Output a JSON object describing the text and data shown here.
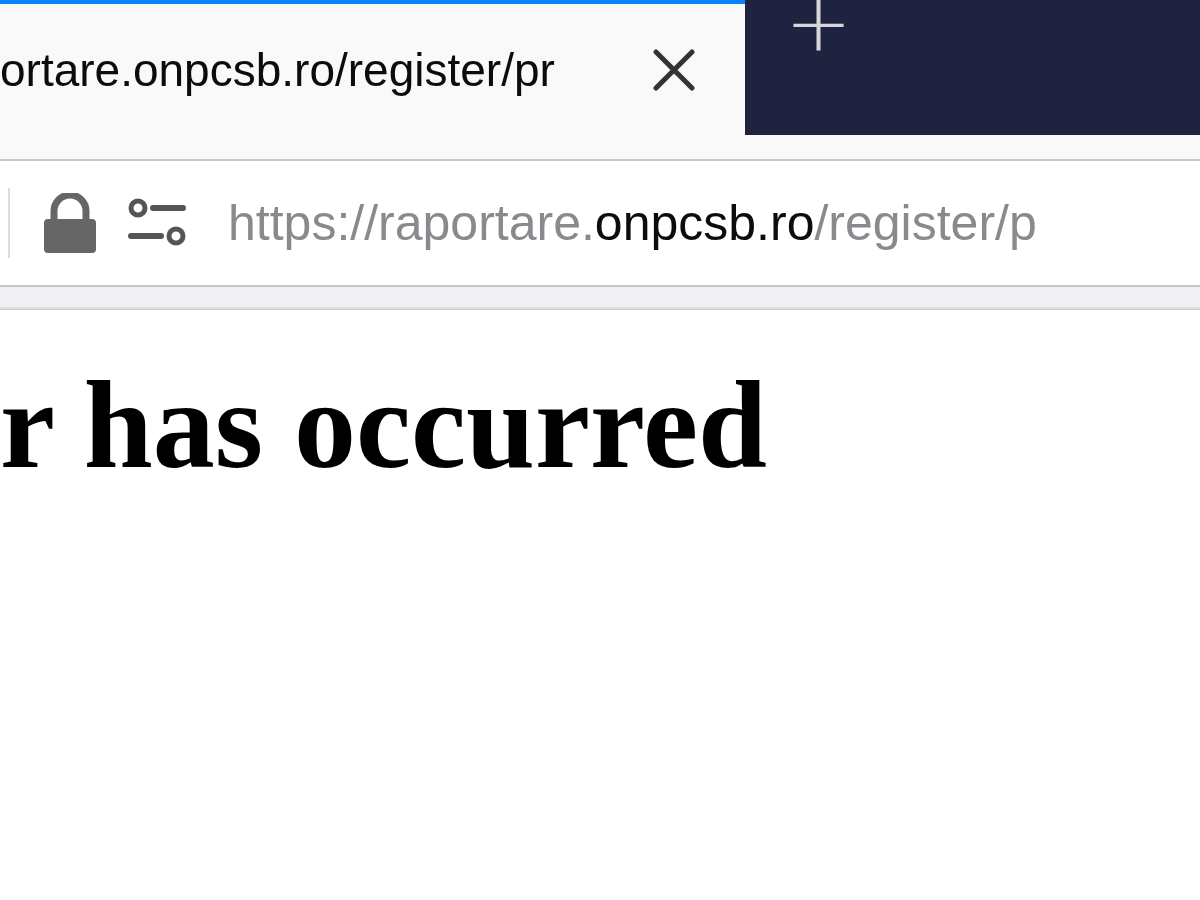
{
  "tabs": [
    {
      "title": "ortare.onpcsb.ro/register/pr",
      "selected": true
    }
  ],
  "new_tab": {
    "label": "+"
  },
  "address_bar": {
    "scheme": "https://raportare.",
    "host": "onpcsb.ro",
    "path": "/register/p"
  },
  "page": {
    "heading": "r has occurred"
  }
}
